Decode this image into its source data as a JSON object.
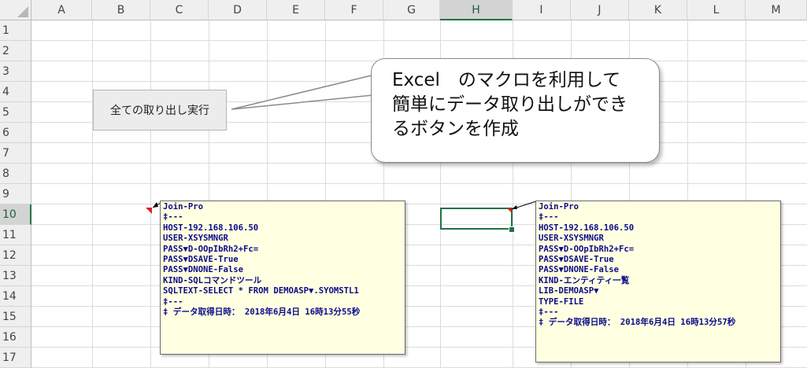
{
  "columns": [
    "A",
    "B",
    "C",
    "D",
    "E",
    "F",
    "G",
    "H",
    "I",
    "J",
    "K",
    "L",
    "M"
  ],
  "rows": [
    "1",
    "2",
    "3",
    "4",
    "5",
    "6",
    "7",
    "8",
    "9",
    "10",
    "11",
    "12",
    "13",
    "14",
    "15",
    "16",
    "17"
  ],
  "selected_column": "H",
  "selected_row": "10",
  "macro_button": {
    "label": "全ての取り出し実行"
  },
  "callout": {
    "text": "Excel　のマクロを利用して\n簡単にデータ取り出しができ\nるボタンを作成"
  },
  "comment_left": {
    "lines": [
      "Join-Pro",
      "‡---",
      "HOST-192.168.106.50",
      "USER-XSYSMNGR",
      "PASS▼D-OOpIbRh2+Fc=",
      "PASS▼DSAVE-True",
      "PASS▼DNONE-False",
      "KIND-SQLコマンドツール",
      "SQLTEXT-SELECT * FROM DEMOASP▼.SYOMSTL1",
      "‡---",
      "‡ データ取得日時： 2018年6月4日 16時13分55秒"
    ]
  },
  "comment_right": {
    "lines": [
      "Join-Pro",
      "‡---",
      "HOST-192.168.106.50",
      "USER-XSYSMNGR",
      "PASS▼D-OOpIbRh2+Fc=",
      "PASS▼DSAVE-True",
      "PASS▼DNONE-False",
      "KIND-エンティティ一覧",
      "LIB-DEMOASP▼",
      "TYPE-FILE",
      "‡---",
      "‡ データ取得日時： 2018年6月4日 16時13分57秒"
    ]
  },
  "colors": {
    "excel_green": "#217346",
    "comment_bg": "#ffffe1",
    "comment_text": "#0b0b8a",
    "comment_indicator": "#e02020"
  }
}
